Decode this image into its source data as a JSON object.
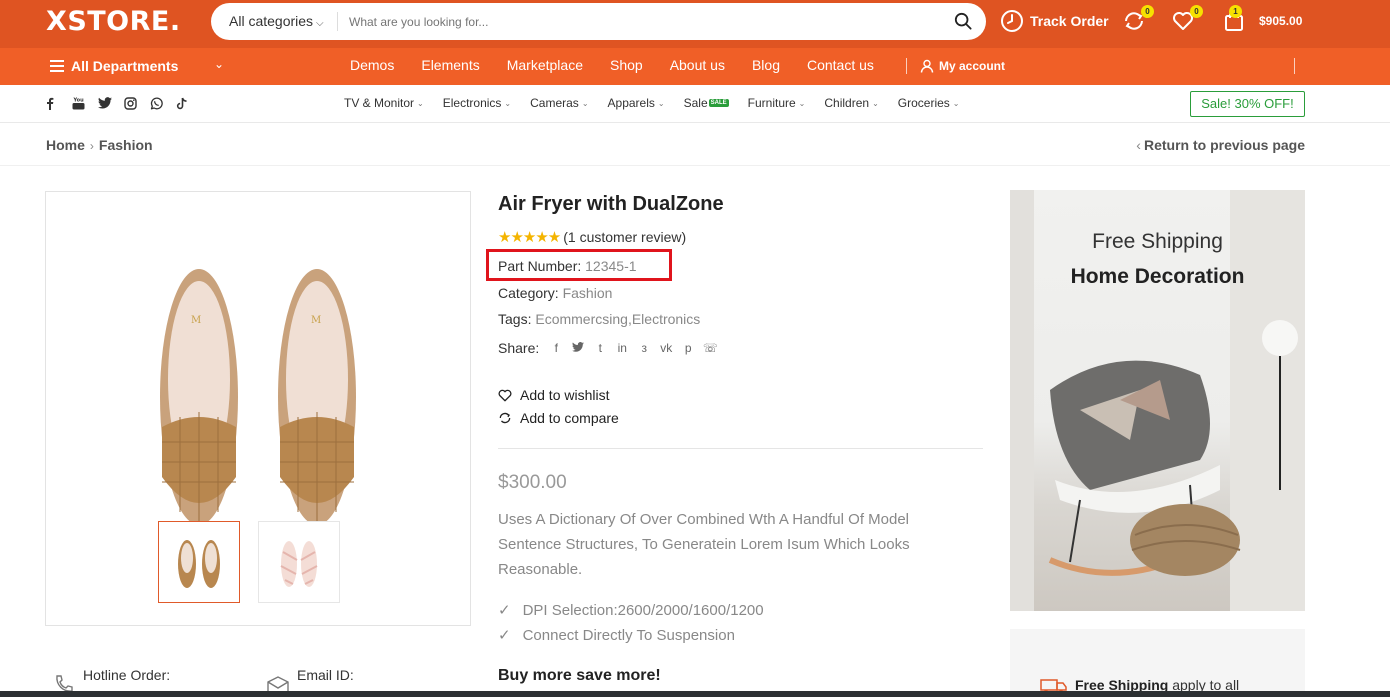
{
  "header": {
    "logo": "XSTORE.",
    "search_category": "All categories",
    "search_placeholder": "What are you looking for...",
    "track_order": "Track Order",
    "compare_count": "0",
    "wishlist_count": "0",
    "cart_count": "1",
    "cart_total": "$905.00"
  },
  "navbar": {
    "all_departments": "All Departments",
    "items": [
      "Demos",
      "Elements",
      "Marketplace",
      "Shop",
      "About us",
      "Blog",
      "Contact us"
    ],
    "my_account": "My account"
  },
  "category_bar": {
    "items": [
      "TV & Monitor",
      "Electronics",
      "Cameras",
      "Apparels",
      "Sale",
      "Furniture",
      "Children",
      "Groceries"
    ],
    "sale_badge": "SALE",
    "sale_button": "Sale! 30% OFF!"
  },
  "breadcrumb": {
    "home": "Home",
    "current": "Fashion",
    "return": "Return to previous page"
  },
  "product": {
    "title": "Air Fryer with DualZone",
    "rating": 5,
    "review_text": "(1 customer review)",
    "part_number_label": "Part Number:",
    "part_number": "12345-1",
    "category_label": "Category:",
    "category": "Fashion",
    "tags_label": "Tags:",
    "tags": "Ecommercsing,Electronics",
    "share_label": "Share:",
    "add_to_wishlist": "Add to wishlist",
    "add_to_compare": "Add to compare",
    "price": "$300.00",
    "description": "Uses A Dictionary Of Over Combined Wth A Handful Of Model Sentence Structures, To Generatein Lorem Isum Which Looks Reasonable.",
    "features": [
      "DPI Selection:2600/2000/1600/1200",
      "Connect Directly To Suspension"
    ],
    "buy_more": "Buy more save more!"
  },
  "promo": {
    "line1": "Free Shipping",
    "line2": "Home Decoration",
    "shipping_bold": "Free Shipping",
    "shipping_rest": "apply to all"
  },
  "contact": {
    "hotline": "Hotline Order:",
    "email": "Email ID:"
  },
  "colors": {
    "topbar": "#df5422",
    "navbar": "#f05f27",
    "sale_green": "#2a9d3a",
    "highlight_red": "#e0141c"
  }
}
